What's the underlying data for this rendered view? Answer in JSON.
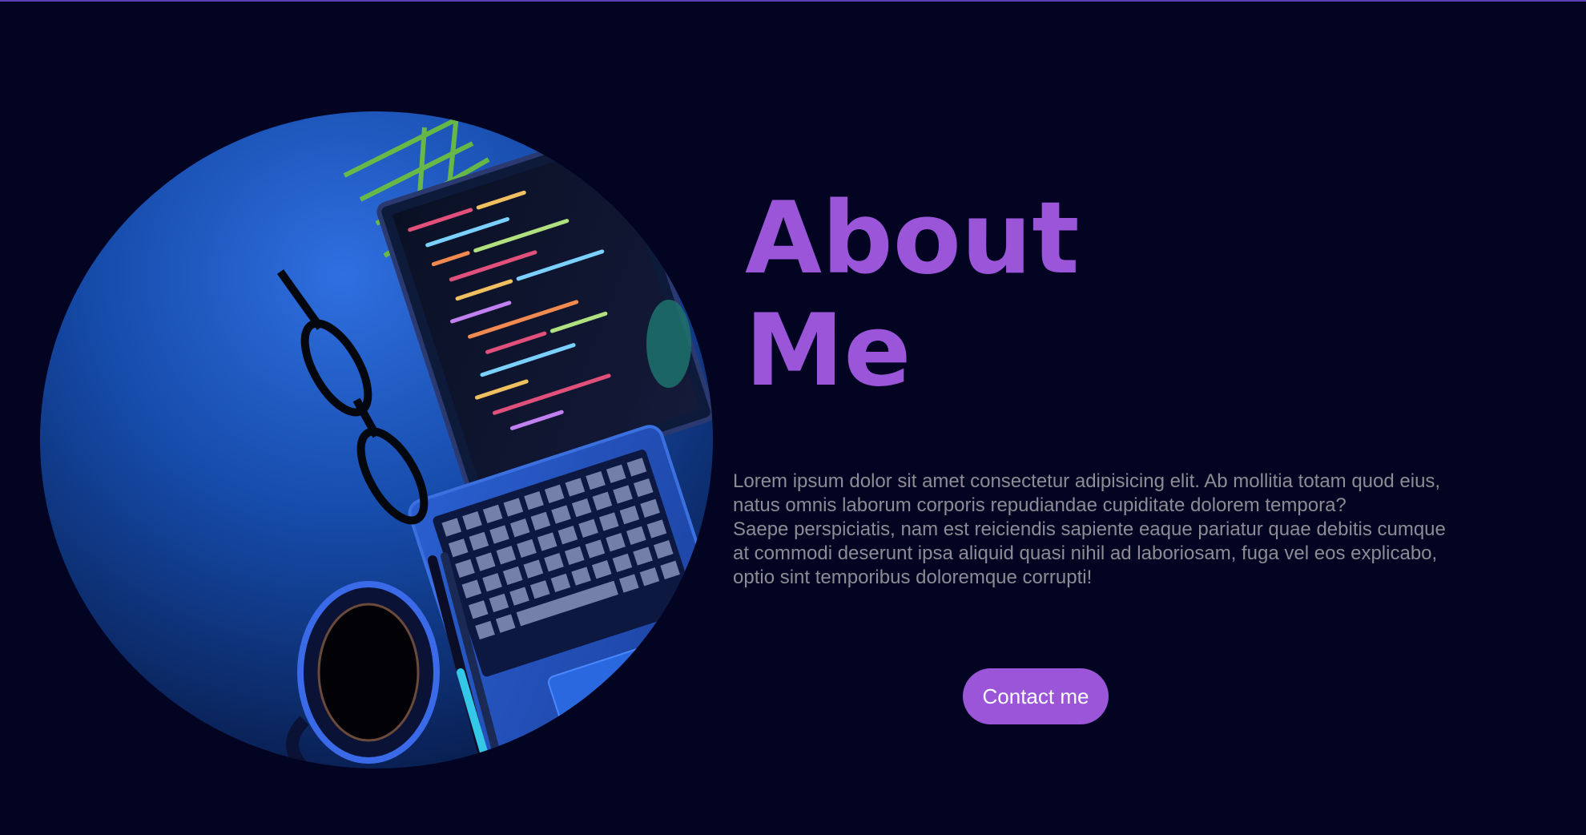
{
  "about": {
    "heading_line1": "About",
    "heading_line2": "Me",
    "paragraph_lines": [
      "Lorem ipsum dolor sit amet consectetur adipisicing elit. Ab mollitia totam quod eius,",
      "natus omnis laborum corporis repudiandae cupiditate dolorem tempora?",
      "Saepe perspiciatis, nam est reiciendis sapiente eaque pariatur quae debitis cumque",
      "at commodi deserunt ipsa aliquid quasi nihil ad laboriosam, fuga vel eos explicabo,",
      "optio sint temporibus doloremque corrupti!"
    ],
    "contact_button_label": "Contact me"
  },
  "colors": {
    "background": "#030322",
    "accent": "#9a55d9",
    "body_text": "#8c8c95",
    "button_text": "#ffffff"
  },
  "hero_image": {
    "icon": "laptop-desk-photo"
  }
}
